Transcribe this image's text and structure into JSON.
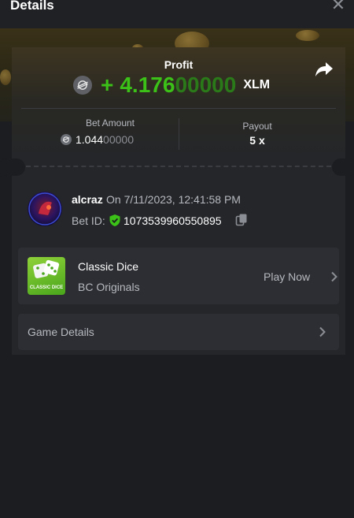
{
  "header": {
    "title": "Details",
    "close_icon": "close-icon"
  },
  "profit": {
    "label": "Profit",
    "sign": "+",
    "amount_main": "4.176",
    "amount_dim": "00000",
    "currency": "XLM",
    "coin_icon": "stellar-icon",
    "color": "#3bc117"
  },
  "bet": {
    "label": "Bet Amount",
    "amount_main": "1.044",
    "amount_dim": "00000"
  },
  "payout": {
    "label": "Payout",
    "value": "5 x"
  },
  "player": {
    "username": "alcraz",
    "date": "On 7/11/2023, 12:41:58 PM",
    "bet_id_label": "Bet ID:",
    "bet_id": "1073539960550895"
  },
  "game": {
    "name": "Classic Dice",
    "provider": "BC Originals",
    "play_label": "Play Now",
    "thumb_text": "CLASSIC DICE"
  },
  "game_details": {
    "label": "Game Details"
  }
}
